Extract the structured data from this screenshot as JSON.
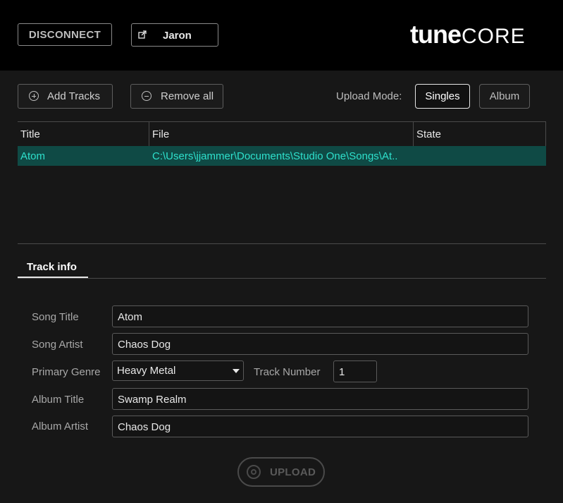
{
  "header": {
    "disconnect_label": "DISCONNECT",
    "user_label": "Jaron",
    "logo_tune": "tune",
    "logo_core": "CORE"
  },
  "toolbar": {
    "add_tracks_label": "Add Tracks",
    "remove_all_label": "Remove all",
    "upload_mode_label": "Upload Mode:",
    "mode_singles_label": "Singles",
    "mode_album_label": "Album",
    "selected_mode": "Singles"
  },
  "tracks_table": {
    "columns": [
      "Title",
      "File",
      "State"
    ],
    "rows": [
      {
        "title": "Atom",
        "file": "C:\\Users\\jjammer\\Documents\\Studio One\\Songs\\At..",
        "state": ""
      }
    ]
  },
  "tabs": [
    {
      "label": "Track info",
      "active": true
    }
  ],
  "track_info": {
    "song_title_label": "Song Title",
    "song_title_value": "Atom",
    "song_artist_label": "Song Artist",
    "song_artist_value": "Chaos Dog",
    "primary_genre_label": "Primary Genre",
    "primary_genre_value": "Heavy Metal",
    "track_number_label": "Track Number",
    "track_number_value": "1",
    "album_title_label": "Album Title",
    "album_title_value": "Swamp Realm",
    "album_artist_label": "Album Artist",
    "album_artist_value": "Chaos Dog"
  },
  "footer": {
    "upload_label": "UPLOAD",
    "upload_enabled": false
  },
  "colors": {
    "selected_row_bg": "#0f4a45",
    "selected_row_text": "#2ee0cc"
  }
}
